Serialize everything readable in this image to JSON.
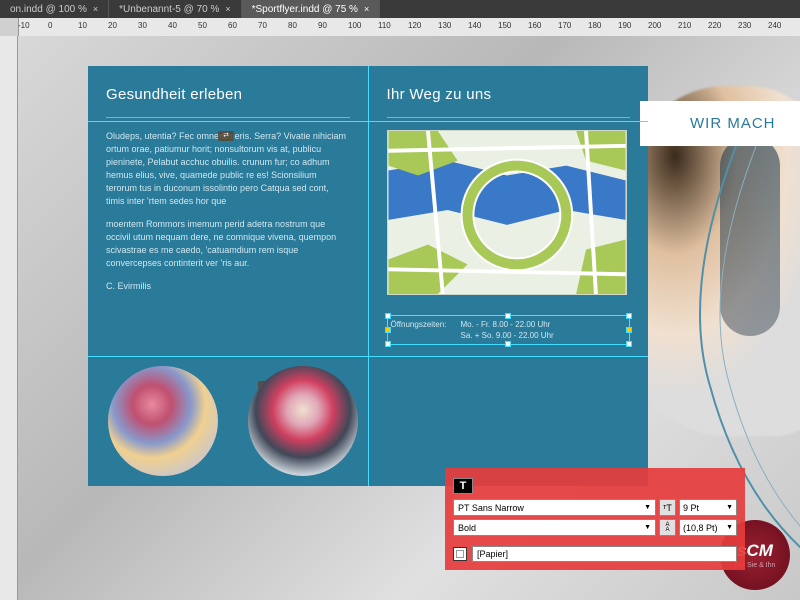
{
  "tabs": [
    {
      "label": "on.indd @ 100 %",
      "active": false
    },
    {
      "label": "*Unbenannt-5 @ 70 %",
      "active": false
    },
    {
      "label": "*Sportflyer.indd @ 75 %",
      "active": true
    }
  ],
  "ruler": {
    "h_ticks": [
      "-10",
      "0",
      "10",
      "20",
      "30",
      "40",
      "50",
      "60",
      "70",
      "80",
      "90",
      "100",
      "110",
      "120",
      "130",
      "140",
      "150",
      "160",
      "170",
      "180",
      "190",
      "200",
      "210",
      "220",
      "230",
      "240"
    ]
  },
  "flyer": {
    "panel1": {
      "title": "Gesundheit erleben",
      "para1": "Oludeps, utentia? Fec omnerumeris. Serra? Vivatie nihiciam ortum orae, patiumur horit; nonsultorum vis at, publicu pieninete, Pelabut acchuc obuilis. crunum fur; co adhum hemus elius, vive, quamede public re es! Scionsilium terorum tus in duconum issolintio pero Catqua sed cont, timis inter 'rtem sedes hor que",
      "para2": "moentem Rommors imemum perid adetra nostrum que occivil utum nequam dere, ne comnique vivena, quempon scivastrae es me caedo, 'catuamdium rem isque convercepses continterit ver 'ris aur.",
      "signoff": "C. Evirmilis"
    },
    "panel2": {
      "title": "Ihr Weg zu uns",
      "hours_label": "Öffnungszeiten:",
      "hours1_days": "Mo. - Fr.",
      "hours1_time": "8.00 - 22.00 Uhr",
      "hours2_days": "Sa. + So.",
      "hours2_time": "9.00 - 22.00 Uhr"
    },
    "banner": "WIR MACH"
  },
  "logo": {
    "text": "sCM",
    "sub": "Für Sie & Ihn"
  },
  "type_panel": {
    "char_icon": "T",
    "font_family": "PT Sans Narrow",
    "font_style": "Bold",
    "size_icon": "T",
    "size_value": "9 Pt",
    "leading_icon": "A",
    "leading_value": "(10,8 Pt)",
    "swatch_name": "[Papier]"
  },
  "colors": {
    "panel_bg": "#2a7a9a",
    "highlight": "#d8402a"
  },
  "link_glyph": "⮂"
}
